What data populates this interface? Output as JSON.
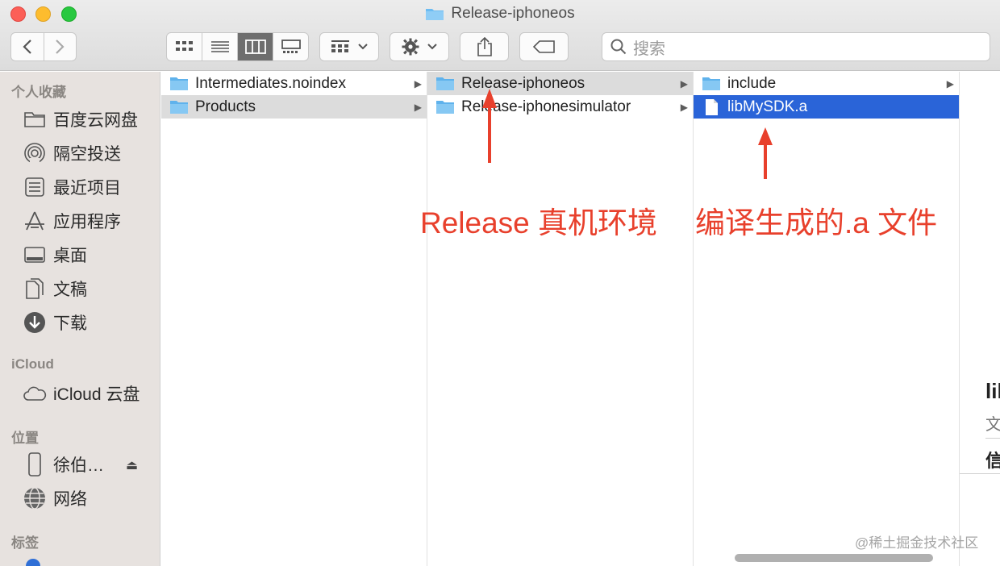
{
  "window": {
    "title": "Release-iphoneos"
  },
  "toolbar": {
    "search_placeholder": "搜索"
  },
  "sidebar": {
    "favorites_title": "个人收藏",
    "favorites": [
      "百度云网盘",
      "隔空投送",
      "最近项目",
      "应用程序",
      "桌面",
      "文稿",
      "下载"
    ],
    "icloud_title": "iCloud",
    "icloud_items": [
      "iCloud 云盘"
    ],
    "locations_title": "位置",
    "locations": [
      "徐伯…",
      "网络"
    ],
    "tags_title": "标签"
  },
  "columns": [
    {
      "items": [
        {
          "name": "Intermediates.noindex"
        },
        {
          "name": "Products"
        }
      ]
    },
    {
      "items": [
        {
          "name": "Release-iphoneos"
        },
        {
          "name": "Release-iphonesimulator"
        }
      ]
    },
    {
      "items": [
        {
          "name": "include"
        },
        {
          "name": "libMySDK.a"
        }
      ]
    }
  ],
  "annotations": {
    "left": "Release 真机环境",
    "right": "编译生成的.a 文件"
  },
  "preview": {
    "title_partial": "lil",
    "kind_partial": "文",
    "info_partial": "信"
  },
  "watermark": "@稀土掘金技术社区",
  "colors": {
    "selection_blue": "#2a64d8",
    "annotation_red": "#e8402c",
    "folder_blue": "#6cbcf2"
  }
}
